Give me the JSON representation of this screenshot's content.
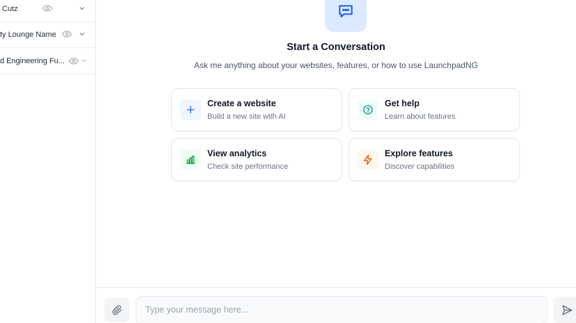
{
  "sidebar": {
    "sites": [
      {
        "name": "Cutz"
      },
      {
        "name": "ty Lounge Name"
      },
      {
        "name": "d Engineering Fu..."
      }
    ]
  },
  "main": {
    "title": "Start a Conversation",
    "subtitle": "Ask me anything about your websites, features, or how to use LaunchpadNG",
    "cards": [
      {
        "title": "Create a website",
        "desc": "Build a new site with AI",
        "icon": "plus-icon",
        "color": "#2563eb",
        "bg": "#eff6ff"
      },
      {
        "title": "Get help",
        "desc": "Learn about features",
        "icon": "help-circle-icon",
        "color": "#0d9488",
        "bg": "#f0fdfa"
      },
      {
        "title": "View analytics",
        "desc": "Check site performance",
        "icon": "bar-chart-icon",
        "color": "#16a34a",
        "bg": "#f0fdf4"
      },
      {
        "title": "Explore features",
        "desc": "Discover capabilities",
        "icon": "zap-icon",
        "color": "#ea580c",
        "bg": "#fff7ed"
      }
    ]
  },
  "composer": {
    "placeholder": "Type your message here...",
    "value": ""
  },
  "colors": {
    "accent": "#2563eb",
    "hero_bg": "#dbeafe",
    "border": "#e5e7eb"
  }
}
